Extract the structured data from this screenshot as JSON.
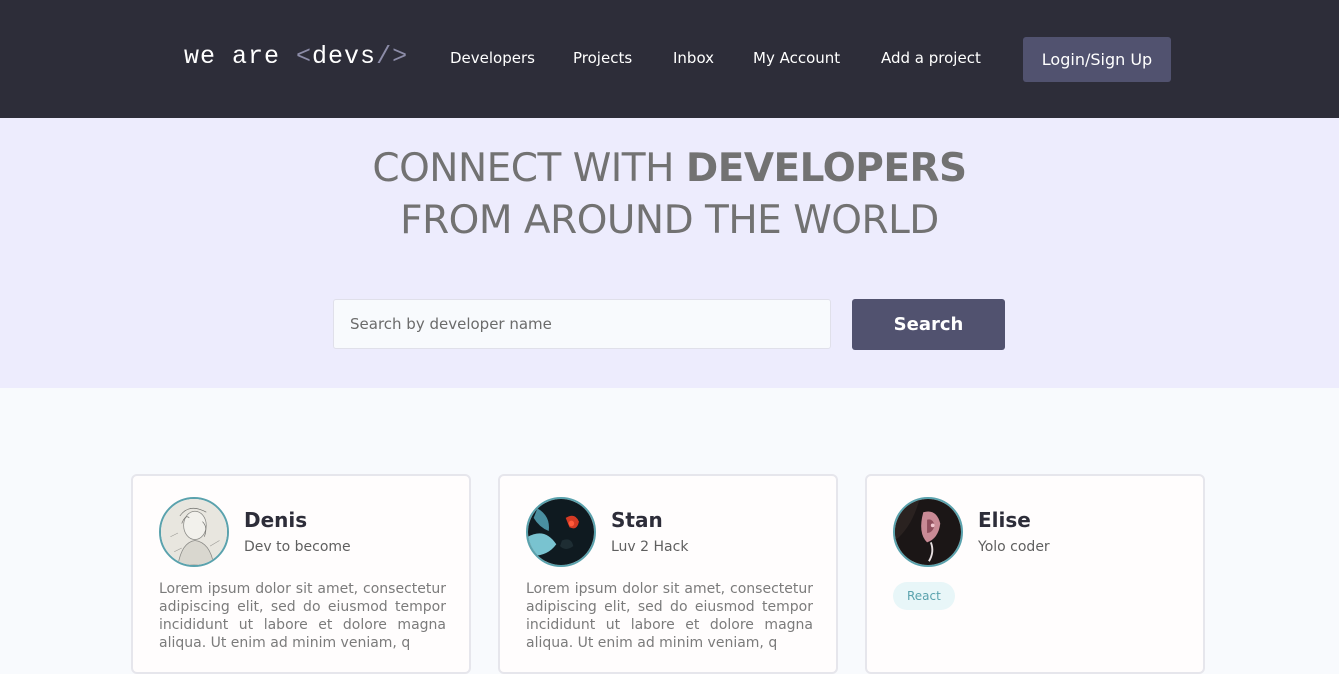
{
  "nav": {
    "logo_text": "we are ",
    "logo_open": "<",
    "logo_word": "devs",
    "logo_close": "/>",
    "links": [
      "Developers",
      "Projects",
      "Inbox",
      "My Account",
      "Add a project"
    ],
    "login_label": "Login/Sign Up"
  },
  "hero": {
    "line1_prefix": "CONNECT WITH ",
    "line1_bold": "DEVELOPERS",
    "line2": "FROM AROUND THE WORLD"
  },
  "search": {
    "placeholder": "Search by developer name",
    "button_label": "Search"
  },
  "developers": [
    {
      "name": "Denis",
      "tagline": "Dev to become",
      "bio": "Lorem ipsum dolor sit amet, consectetur adipiscing elit, sed do eiusmod tempor incididunt ut labore et dolore magna aliqua. Ut enim ad minim veniam, q"
    },
    {
      "name": "Stan",
      "tagline": "Luv 2 Hack",
      "bio": "Lorem ipsum dolor sit amet, consectetur adipiscing elit, sed do eiusmod tempor incididunt ut labore et dolore magna aliqua. Ut enim ad minim veniam, q"
    },
    {
      "name": "Elise",
      "tagline": "Yolo coder",
      "tags": [
        "React"
      ]
    }
  ],
  "colors": {
    "nav_bg": "#2d2d39",
    "hero_bg": "#edecfd",
    "accent_button": "#51526f",
    "avatar_ring": "#5aa2ad"
  }
}
